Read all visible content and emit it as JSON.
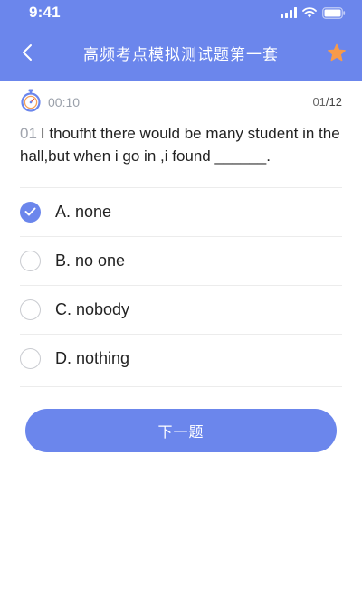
{
  "status_bar": {
    "time": "9:41"
  },
  "header": {
    "title": "高频考点模拟测试题第一套"
  },
  "timer": {
    "elapsed": "00:10"
  },
  "progress": {
    "current": "01",
    "total": "/12"
  },
  "question": {
    "number": "01",
    "text": "I thoufht there would be many student in the hall,but when i go in ,i found ______."
  },
  "options": [
    {
      "label": "A. none",
      "selected": true
    },
    {
      "label": "B. no one",
      "selected": false
    },
    {
      "label": "C. nobody",
      "selected": false
    },
    {
      "label": "D. nothing",
      "selected": false
    }
  ],
  "actions": {
    "next_label": "下一题"
  },
  "colors": {
    "accent": "#6b86ec",
    "star": "#f79a4a"
  },
  "icons": {
    "back": "chevron-left-icon",
    "favorite": "star-icon",
    "timer": "stopwatch-icon",
    "selected": "checkmark-icon"
  }
}
